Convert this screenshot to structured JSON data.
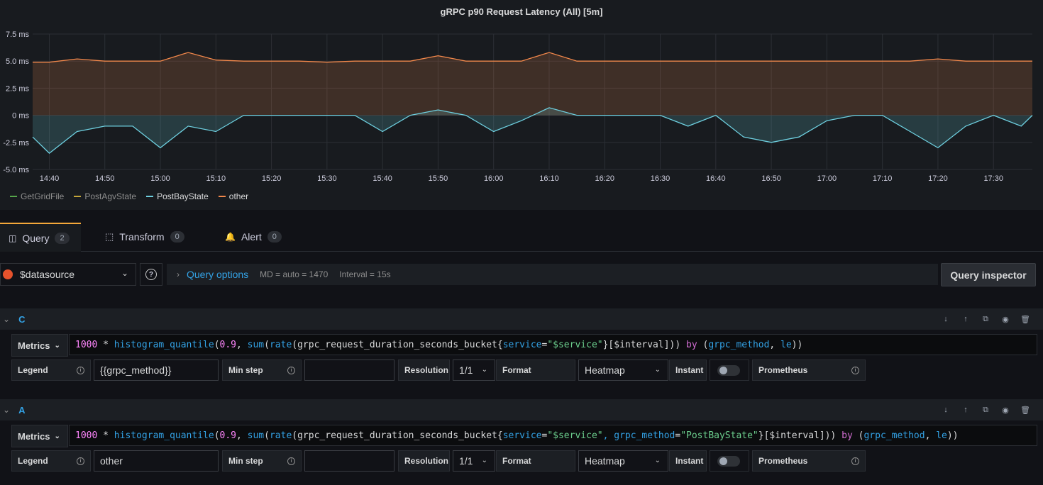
{
  "panel": {
    "title": "gRPC p90 Request Latency (All) [5m]"
  },
  "chart_data": {
    "type": "line",
    "title": "gRPC p90 Request Latency (All) [5m]",
    "y_ticks": [
      "7.5 ms",
      "5.0 ms",
      "2.5 ms",
      "0 ms",
      "-2.5 ms",
      "-5.0 ms"
    ],
    "ylim": [
      -5.0,
      7.5
    ],
    "x_ticks": [
      "14:40",
      "14:50",
      "15:00",
      "15:10",
      "15:20",
      "15:30",
      "15:40",
      "15:50",
      "16:00",
      "16:10",
      "16:20",
      "16:30",
      "16:40",
      "16:50",
      "17:00",
      "17:10",
      "17:20",
      "17:30"
    ],
    "grid": true,
    "legend_position": "bottom-left",
    "series": [
      {
        "name": "GetGridFile",
        "color": "#56a64b",
        "values": []
      },
      {
        "name": "PostAgvState",
        "color": "#c4a63a",
        "values": []
      },
      {
        "name": "PostBayState",
        "color": "#6ed0e0",
        "x": [
          "14:37",
          "14:40",
          "14:45",
          "14:50",
          "14:55",
          "15:00",
          "15:05",
          "15:10",
          "15:15",
          "15:20",
          "15:25",
          "15:30",
          "15:35",
          "15:40",
          "15:45",
          "15:50",
          "15:55",
          "16:00",
          "16:05",
          "16:10",
          "16:15",
          "16:20",
          "16:25",
          "16:30",
          "16:35",
          "16:40",
          "16:45",
          "16:50",
          "16:55",
          "17:00",
          "17:05",
          "17:10",
          "17:15",
          "17:20",
          "17:25",
          "17:30",
          "17:35",
          "17:37"
        ],
        "values": [
          -2.0,
          -3.5,
          -1.5,
          -1.0,
          -1.0,
          -3.0,
          -1.0,
          -1.5,
          0,
          0,
          0,
          0,
          0,
          -1.5,
          0,
          0.5,
          0,
          -1.5,
          -0.5,
          0.7,
          0,
          0,
          0,
          0,
          -1.0,
          0,
          -2.0,
          -2.5,
          -2.0,
          -0.5,
          0,
          0,
          -1.5,
          -3.0,
          -1.0,
          0,
          -1.0,
          0
        ]
      },
      {
        "name": "other",
        "color": "#f2884b",
        "x": [
          "14:37",
          "14:40",
          "14:45",
          "14:50",
          "14:55",
          "15:00",
          "15:05",
          "15:10",
          "15:15",
          "15:20",
          "15:25",
          "15:30",
          "15:35",
          "15:40",
          "15:45",
          "15:50",
          "15:55",
          "16:00",
          "16:05",
          "16:10",
          "16:15",
          "16:20",
          "16:25",
          "16:30",
          "16:35",
          "16:40",
          "16:45",
          "16:50",
          "16:55",
          "17:00",
          "17:05",
          "17:10",
          "17:15",
          "17:20",
          "17:25",
          "17:30",
          "17:35",
          "17:37"
        ],
        "values": [
          4.9,
          4.9,
          5.2,
          5.0,
          5.0,
          5.0,
          5.8,
          5.1,
          5.0,
          5.0,
          5.0,
          4.9,
          5.0,
          5.0,
          5.0,
          5.5,
          5.0,
          5.0,
          5.0,
          5.8,
          5.0,
          5.0,
          5.0,
          5.0,
          5.0,
          5.0,
          5.0,
          5.0,
          5.0,
          5.0,
          5.0,
          5.0,
          5.0,
          5.2,
          5.0,
          5.0,
          5.0,
          5.0
        ]
      }
    ]
  },
  "tabs": [
    {
      "label": "Query",
      "count": "2"
    },
    {
      "label": "Transform",
      "count": "0"
    },
    {
      "label": "Alert",
      "count": "0"
    }
  ],
  "toolbar": {
    "datasource": "$datasource",
    "query_options_label": "Query options",
    "md": "MD = auto = 1470",
    "interval": "Interval = 15s",
    "query_inspector": "Query inspector"
  },
  "queries": [
    {
      "ref": "C",
      "metrics_label": "Metrics",
      "expr_parts": {
        "a": "1000",
        "b": " * ",
        "c": "histogram_quantile",
        "d": "(",
        "e": "0.9",
        "f": ", ",
        "g": "sum",
        "h": "(",
        "i": "rate",
        "j": "(grpc_request_duration_seconds_bucket{",
        "k": "service",
        "l": "=",
        "m": "\"$service\"",
        "n": "}[$interval])) ",
        "o": "by",
        "p": " (",
        "q": "grpc_method",
        "r": ", ",
        "s": "le",
        "t": "))"
      },
      "legend_label": "Legend",
      "legend_value": "{{grpc_method}}",
      "min_step_label": "Min step",
      "min_step_value": "",
      "resolution_label": "Resolution",
      "resolution_value": "1/1",
      "format_label": "Format",
      "format_value": "Heatmap",
      "instant_label": "Instant",
      "prom_label": "Prometheus"
    },
    {
      "ref": "A",
      "metrics_label": "Metrics",
      "expr_parts": {
        "a": "1000",
        "b": " * ",
        "c": "histogram_quantile",
        "d": "(",
        "e": "0.9",
        "f": ", ",
        "g": "sum",
        "h": "(",
        "i": "rate",
        "j": "(grpc_request_duration_seconds_bucket{",
        "k": "service",
        "l": "=",
        "m": "\"$service\"",
        "k2": ", grpc_method",
        "l2": "=",
        "m2": "\"PostBayState\"",
        "n": "}[$interval])) ",
        "o": "by",
        "p": " (",
        "q": "grpc_method",
        "r": ", ",
        "s": "le",
        "t": "))"
      },
      "legend_label": "Legend",
      "legend_value": "other",
      "min_step_label": "Min step",
      "min_step_value": "",
      "resolution_label": "Resolution",
      "resolution_value": "1/1",
      "format_label": "Format",
      "format_value": "Heatmap",
      "instant_label": "Instant",
      "prom_label": "Prometheus"
    }
  ]
}
